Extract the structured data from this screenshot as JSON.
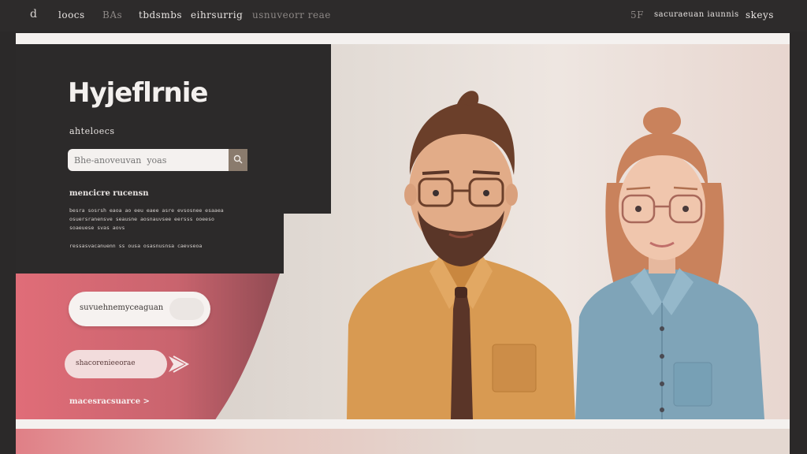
{
  "nav": {
    "logo": "d",
    "items": [
      "loocs",
      "BAs",
      "tbdsmbs",
      "eihrsurrig",
      "usnuveorr reae"
    ],
    "right_icon_text": "5F",
    "right_items": [
      "sacuraeuan iaunnis",
      "skeys"
    ]
  },
  "hero": {
    "title": "Hyjeflrnie",
    "subtitle": "ahteloecs",
    "search_placeholder": "Bhe-anoveuvan  yoas",
    "section_heading": "mencicre rucensn",
    "body_line1": "besra sosrsh eaoa ao eeu eaee asre evsosnee esaaea",
    "body_line2": "osuersranensve seausne aosnauvsee eersss ooeeso",
    "body_line3": "soaeuese svas aovs",
    "body_line4": "ressasvacanuenn ss ousa osasnusnsa caevseoa",
    "primary_button": "suvuehnemyceaguan",
    "secondary_button": "shacorenieeorae",
    "bottom_link": "macesracsuarce >"
  },
  "colors": {
    "nav_bg": "#2d2b2b",
    "panel_dark": "#2c2a2a",
    "accent_pink": "#e06d78",
    "search_button": "#8a7b6d"
  }
}
